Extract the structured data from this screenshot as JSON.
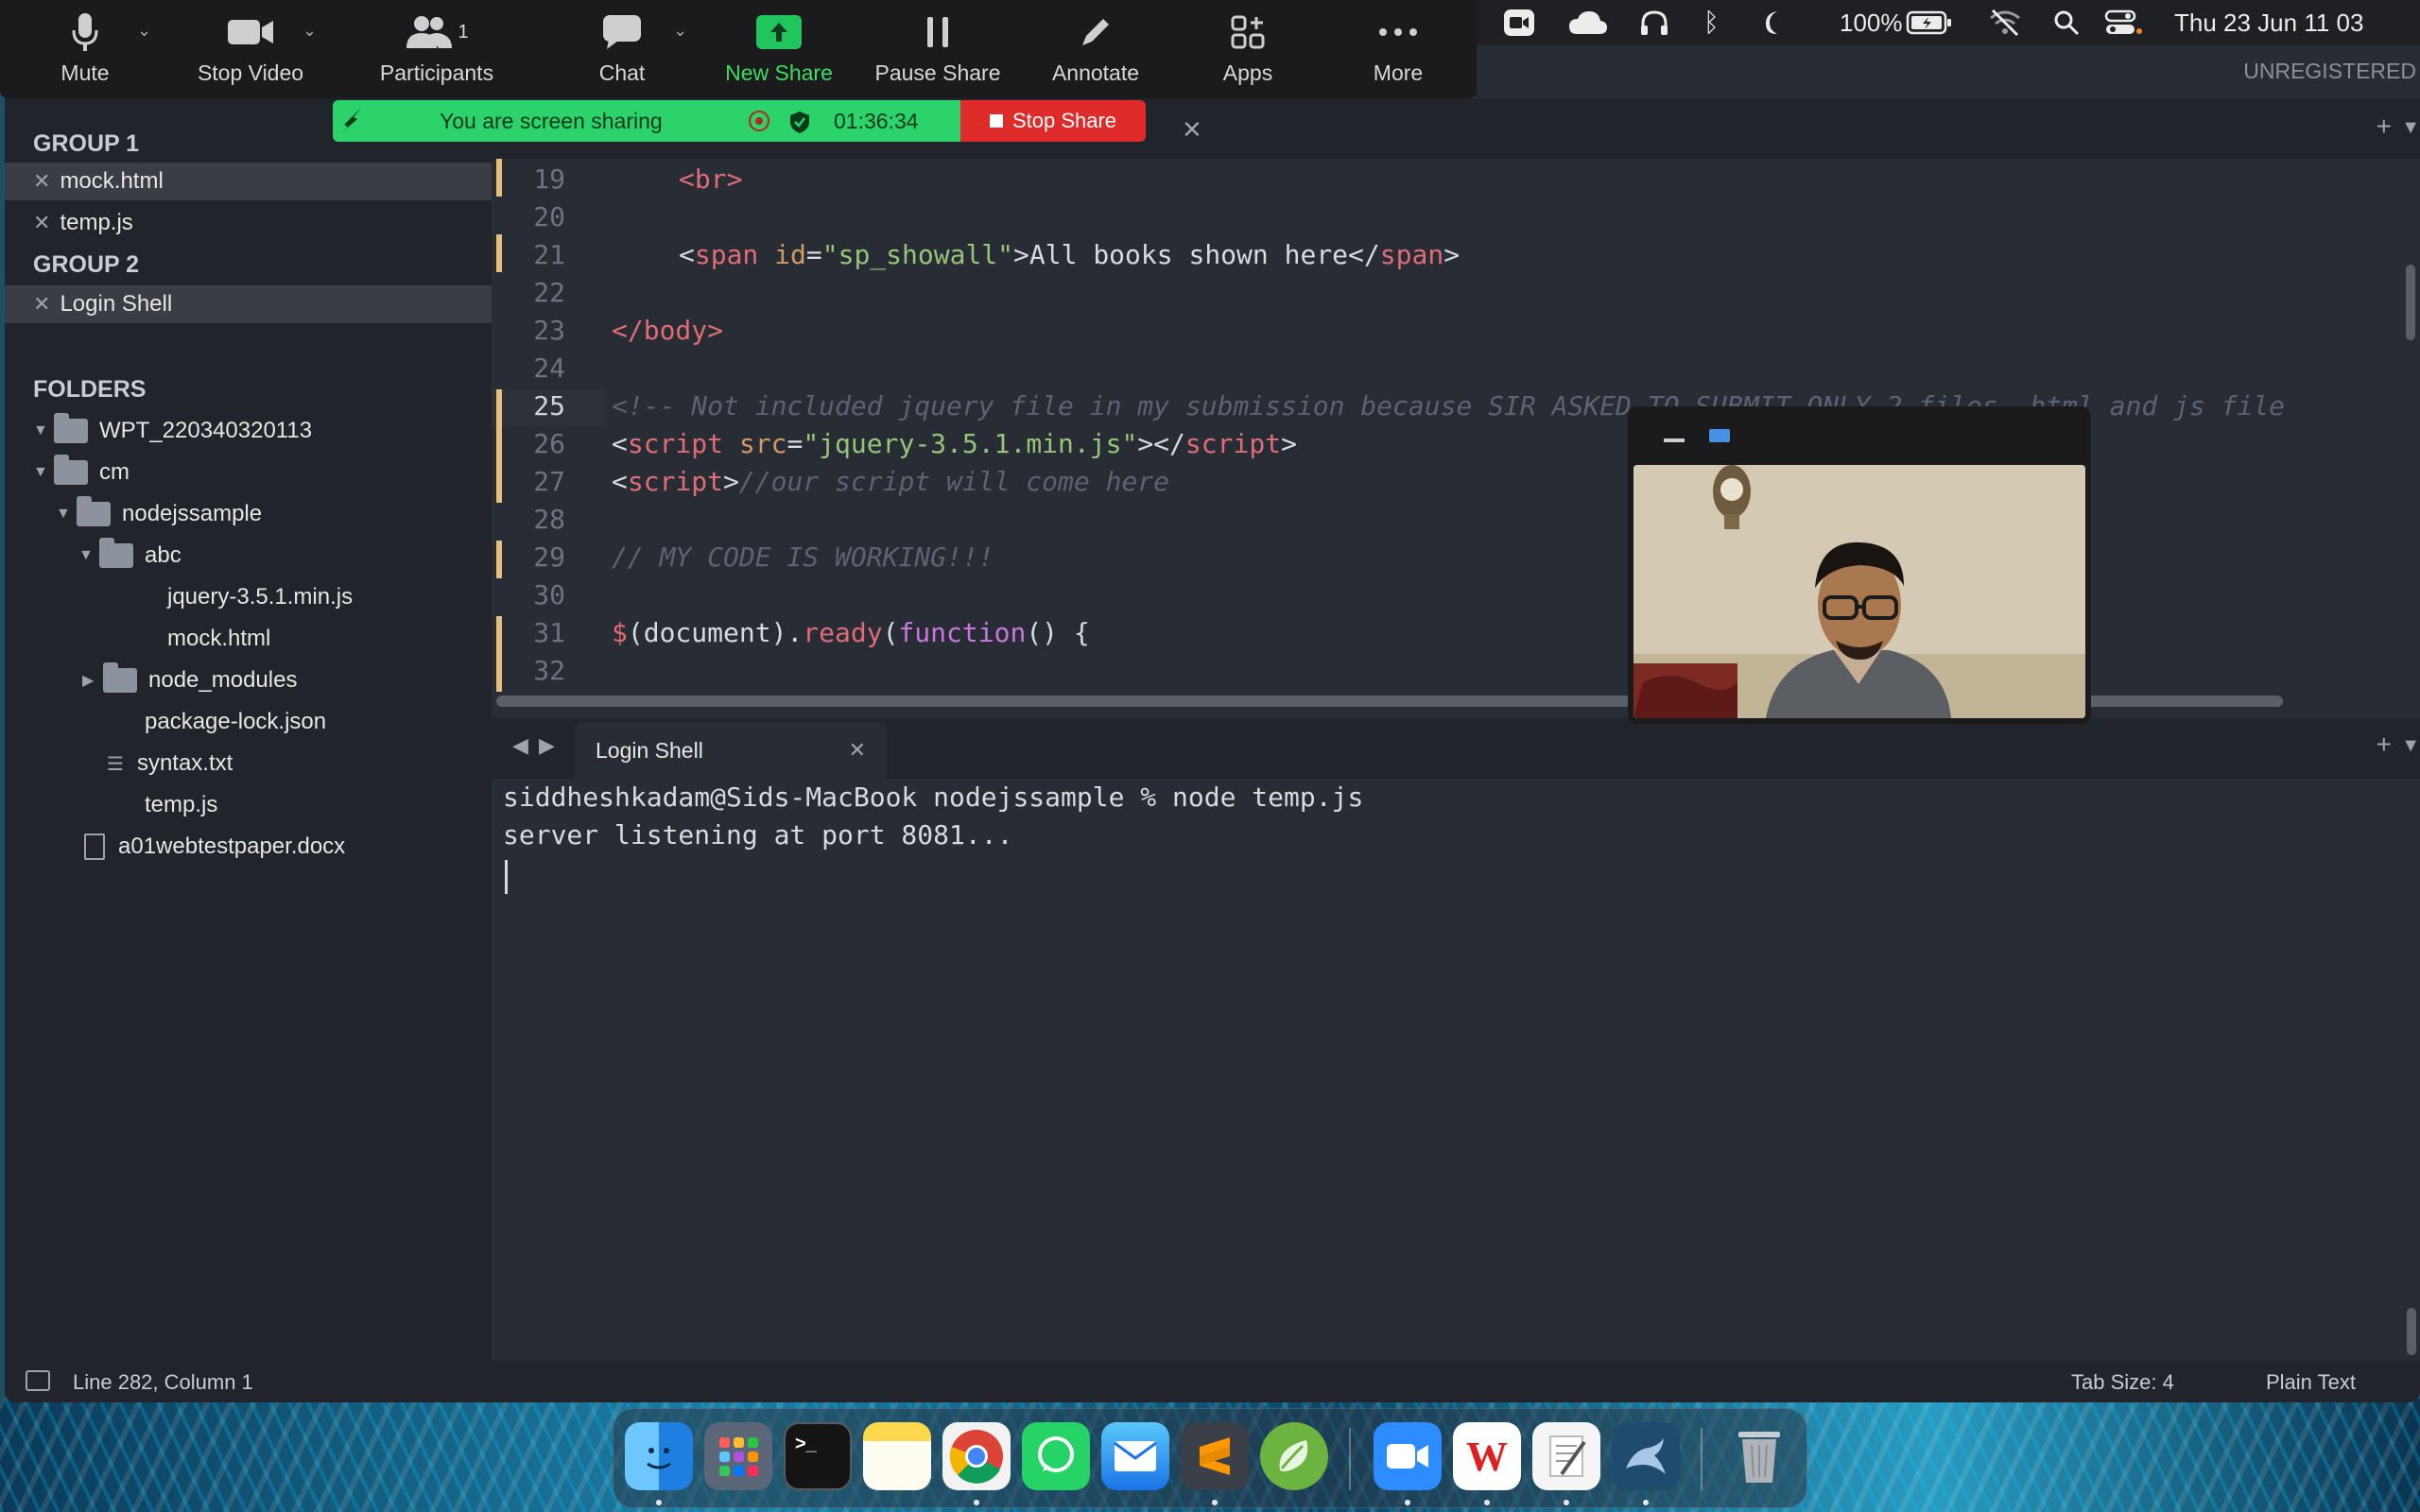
{
  "zoom_toolbar": {
    "mute": "Mute",
    "stop_video": "Stop Video",
    "participants": "Participants",
    "participants_count": "1",
    "chat": "Chat",
    "new_share": "New Share",
    "pause_share": "Pause Share",
    "annotate": "Annotate",
    "apps": "Apps",
    "more": "More"
  },
  "share_banner": {
    "status": "You are screen sharing",
    "timer": "01:36:34",
    "stop_label": "Stop Share"
  },
  "menubar": {
    "battery": "100%",
    "datetime": "Thu 23 Jun  11 03"
  },
  "unregistered": "UNREGISTERED",
  "sidebar": {
    "group1": "GROUP 1",
    "group1_files": [
      "mock.html",
      "temp.js"
    ],
    "group2": "GROUP 2",
    "group2_files": [
      "Login Shell"
    ],
    "folders_header": "FOLDERS",
    "tree": {
      "root1": "WPT_220340320113",
      "root2": "cm",
      "nodejssample": "nodejssample",
      "abc": "abc",
      "jquery": "jquery-3.5.1.min.js",
      "mock": "mock.html",
      "node_modules": "node_modules",
      "package_lock": "package-lock.json",
      "syntax": "syntax.txt",
      "temp": "temp.js",
      "docx": "a01webtestpaper.docx"
    }
  },
  "editor": {
    "line_numbers": [
      "19",
      "20",
      "21",
      "22",
      "23",
      "24",
      "25",
      "26",
      "27",
      "28",
      "29",
      "30",
      "31",
      "32"
    ],
    "line19": "<br>",
    "line21_id_val": "\"sp_showall\"",
    "line21_text": "All books shown here",
    "line23": "</body>",
    "line25": "<!-- Not included jquery file in my submission because SIR ASKED TO SUBMIT ONLY 2 files, html and js file",
    "line26_src": "\"jquery-3.5.1.min.js\"",
    "line27_comment": "//our script will come here",
    "line29": "// MY CODE IS WORKING!!!",
    "line31_doc": "document",
    "line31_ready": "ready",
    "line31_function": "function"
  },
  "terminal": {
    "tab_label": "Login Shell",
    "lines": [
      "siddheshkadam@Sids-MacBook nodejssample % node temp.js",
      "server listening at port 8081..."
    ]
  },
  "statusbar": {
    "position": "Line 282, Column 1",
    "tab_size": "Tab Size: 4",
    "syntax": "Plain Text"
  },
  "dock": {
    "wps_label": "W"
  },
  "colors": {
    "accent_green": "#2bd36a",
    "stop_red": "#e02b2b",
    "editor_bg": "#282c34",
    "sidebar_bg": "#21252b"
  }
}
